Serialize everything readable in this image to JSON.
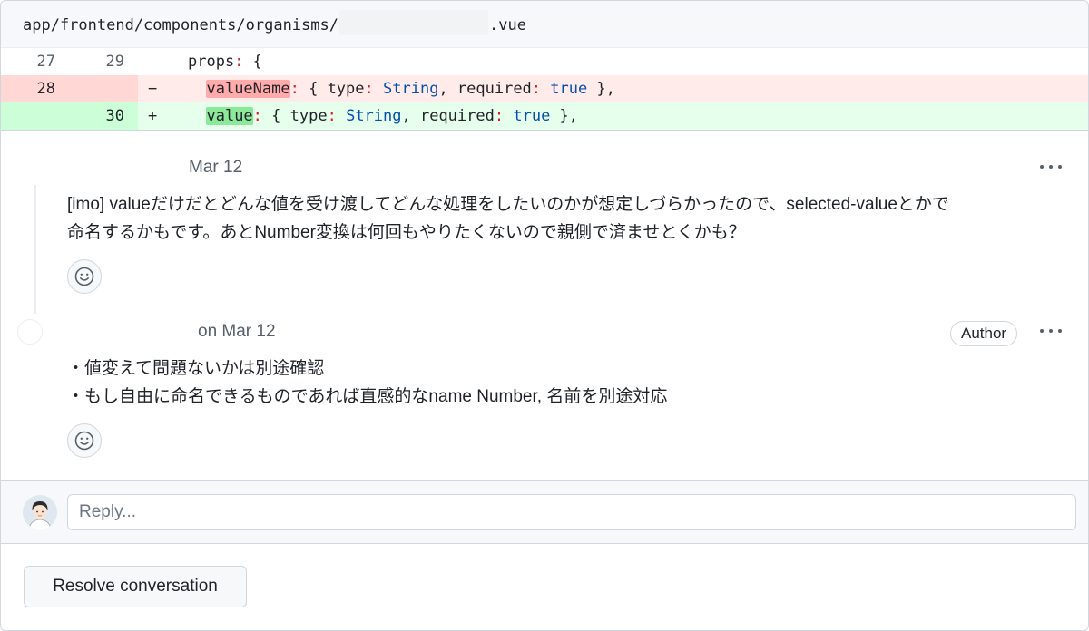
{
  "file": {
    "path_prefix": "app/frontend/components/organisms/",
    "path_suffix": ".vue"
  },
  "diff": {
    "lines": [
      {
        "type": "context",
        "old": "27",
        "new": "29",
        "marker": "",
        "indent": "",
        "parts": [
          {
            "text": "props",
            "cls": ""
          },
          {
            "text": ":",
            "cls": "key"
          },
          {
            "text": " {",
            "cls": ""
          }
        ]
      },
      {
        "type": "del",
        "old": "28",
        "new": "",
        "marker": "−",
        "indent": "  ",
        "parts": [
          {
            "text": "valueName",
            "cls": "hl-del"
          },
          {
            "text": ":",
            "cls": "key"
          },
          {
            "text": " { type",
            "cls": ""
          },
          {
            "text": ":",
            "cls": "key"
          },
          {
            "text": " ",
            "cls": ""
          },
          {
            "text": "String",
            "cls": "kw"
          },
          {
            "text": ", required",
            "cls": ""
          },
          {
            "text": ":",
            "cls": "key"
          },
          {
            "text": " ",
            "cls": ""
          },
          {
            "text": "true",
            "cls": "kw"
          },
          {
            "text": " },",
            "cls": ""
          }
        ]
      },
      {
        "type": "add",
        "old": "",
        "new": "30",
        "marker": "+",
        "indent": "  ",
        "parts": [
          {
            "text": "value",
            "cls": "hl-add"
          },
          {
            "text": ":",
            "cls": "key"
          },
          {
            "text": " { type",
            "cls": ""
          },
          {
            "text": ":",
            "cls": "key"
          },
          {
            "text": " ",
            "cls": ""
          },
          {
            "text": "String",
            "cls": "kw"
          },
          {
            "text": ", required",
            "cls": ""
          },
          {
            "text": ":",
            "cls": "key"
          },
          {
            "text": " ",
            "cls": ""
          },
          {
            "text": "true",
            "cls": "kw"
          },
          {
            "text": " },",
            "cls": ""
          }
        ]
      }
    ]
  },
  "thread": {
    "comments": [
      {
        "date": "Mar 12",
        "body": [
          "[imo] valueだけだとどんな値を受け渡してどんな処理をしたいのかが想定しづらかったので、selected-valueとかで",
          "命名するかもです。あとNumber変換は何回もやりたくないので親側で済ませとくかも？"
        ]
      },
      {
        "date": "on Mar 12",
        "badge": "Author",
        "body": [
          "・値変えて問題ないかは別途確認",
          "・もし自由に命名できるものであれば直感的なname Number, 名前を別途対応"
        ]
      }
    ]
  },
  "reply": {
    "placeholder": "Reply..."
  },
  "resolve": {
    "label": "Resolve conversation"
  },
  "icons": {
    "more": "kebab-horizontal-icon",
    "reaction": "smiley-icon"
  }
}
